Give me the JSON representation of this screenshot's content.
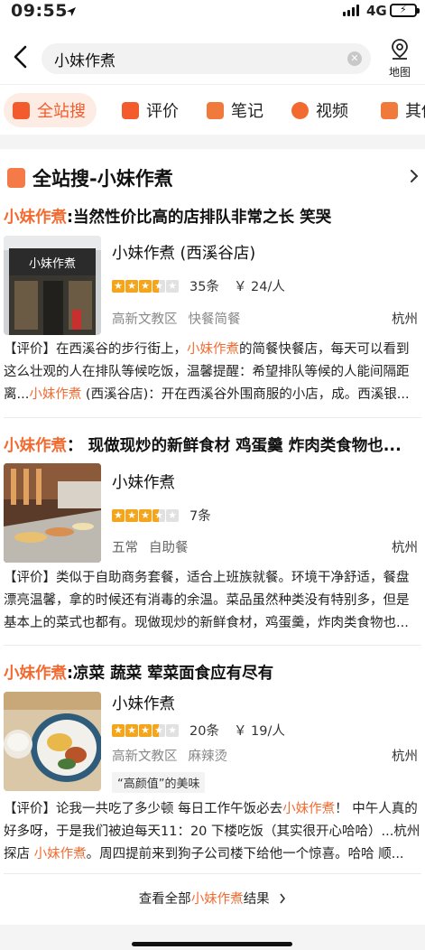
{
  "status_bar": {
    "time": "09:55",
    "network": "4G"
  },
  "search": {
    "query": "小妹作煮",
    "map_label": "地图"
  },
  "tabs": [
    {
      "label": "全站搜",
      "icon": "all-search-icon",
      "color": "#f35b2c"
    },
    {
      "label": "评价",
      "icon": "review-icon",
      "color": "#f35b2c"
    },
    {
      "label": "笔记",
      "icon": "note-icon",
      "color": "#f07a3c"
    },
    {
      "label": "视频",
      "icon": "video-icon",
      "color": "#f36a30"
    },
    {
      "label": "其他",
      "icon": "other-icon",
      "color": "#f07a3c"
    }
  ],
  "section": {
    "title": "全站搜-小妹作煮"
  },
  "results": [
    {
      "headline_hl": "小妹作煮",
      "headline_rest": ":当然性价比高的店排队非常之长 笑哭",
      "shop_name": "小妹作煮 (西溪谷店)",
      "thumb_text": "小妹作煮",
      "stars": 3.5,
      "reviews": "35条",
      "price": "￥ 24/人",
      "area": "高新文教区",
      "category": "快餐简餐",
      "city": "杭州",
      "tag": "",
      "review_parts": [
        "【评价】在西溪谷的步行街上，",
        "小妹作煮",
        "的简餐快餐店，每天可以看到这么壮观的人在排队等候吃饭，温馨提醒：希望排队等候的人能间隔距离...",
        "小妹作煮",
        " (西溪谷店)：开在西溪谷外围商服的小店，成。西溪银..."
      ]
    },
    {
      "headline_hl": "小妹作煮",
      "headline_rest": "： 现做现炒的新鲜食材 鸡蛋羹 炸肉类食物也...",
      "shop_name": "小妹作煮",
      "stars": 3.5,
      "reviews": "7条",
      "price": "",
      "area": "五常",
      "category": "自助餐",
      "city": "杭州",
      "tag": "",
      "review_parts": [
        "【评价】类似于自助商务套餐，适合上班族就餐。环境干净舒适，餐盘漂亮温馨，拿的时候还有消毒的余温。菜品虽然种类没有特别多，但是基本上的菜式也都有。现做现炒的新鲜食材，鸡蛋羹，炸肉类食物也..."
      ]
    },
    {
      "headline_hl": "小妹作煮",
      "headline_rest": ":凉菜 蔬菜 荤菜面食应有尽有",
      "shop_name": "小妹作煮",
      "stars": 3.5,
      "reviews": "20条",
      "price": "￥ 19/人",
      "area": "高新文教区",
      "category": "麻辣烫",
      "city": "杭州",
      "tag": "“高颜值”的美味",
      "review_parts": [
        "【评价】论我一共吃了多少顿 每日工作午饭必去",
        "小妹作煮",
        "！ 中午人真的好多呀，于是我们被迫每天11：20 下楼吃饭（其实很开心哈哈）...杭州探店 ",
        "小妹作煮",
        "。周四提前来到狗子公司楼下给他一个惊喜。哈哈 顺..."
      ]
    }
  ],
  "more": {
    "prefix": "查看全部",
    "hl": "小妹作煮",
    "suffix": "结果"
  },
  "colors": {
    "accent": "#f36a30",
    "star": "#f4a51c"
  }
}
